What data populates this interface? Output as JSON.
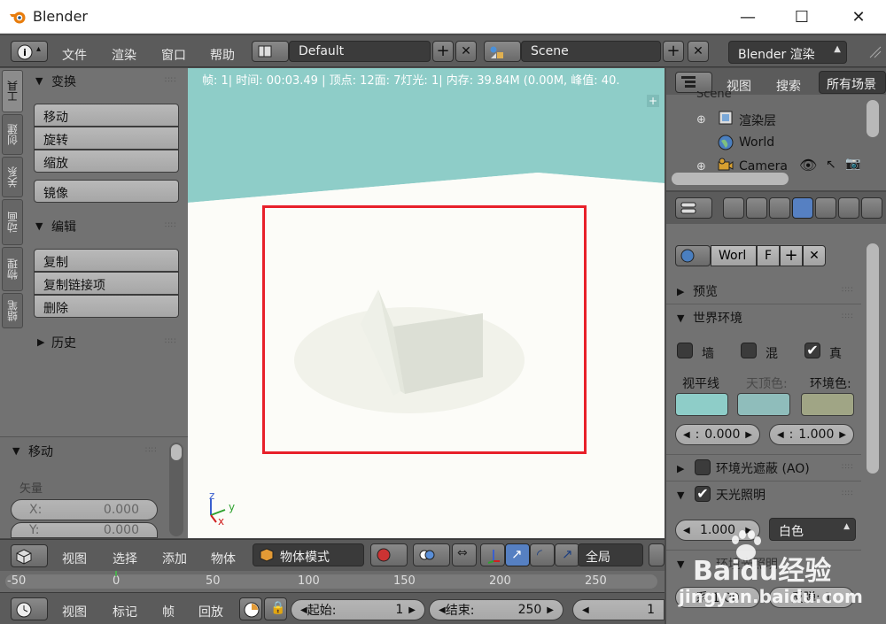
{
  "window": {
    "title": "Blender",
    "minimize": "—",
    "maximize": "☐",
    "close": "✕"
  },
  "topbar": {
    "menus": [
      "文件",
      "渲染",
      "窗口",
      "帮助"
    ],
    "layout_value": "Default",
    "scene_value": "Scene",
    "engine_value": "Blender 渲染"
  },
  "tabs": [
    "工具",
    "创建",
    "关系",
    "动画",
    "物理",
    "蜡笔"
  ],
  "toolshelf": {
    "transform_title": "变换",
    "transform_buttons": [
      "移动",
      "旋转",
      "缩放"
    ],
    "mirror": "镜像",
    "edit_title": "编辑",
    "edit_buttons": [
      "复制",
      "复制链接项",
      "删除"
    ],
    "history_title": "历史"
  },
  "operator_panel": {
    "title": "移动",
    "vector_label": "矢量",
    "x_label": "X:",
    "x_value": "0.000",
    "y_label": "Y:",
    "y_value": "0.000"
  },
  "viewport": {
    "info": "帧: 1| 时间: 00:03.49 | 顶点: 12面: 7灯光: 1| 内存: 39.84M (0.00M, 峰值: 40.",
    "axis_x": "x",
    "axis_y": "y",
    "axis_z": "z"
  },
  "outliner": {
    "view_menu": "视图",
    "search_menu": "搜索",
    "filter_value": "所有场景",
    "scene_item": "Scene",
    "items": [
      "渲染层",
      "World",
      "Camera"
    ]
  },
  "properties": {
    "world_name": "Worl",
    "fake_user": "F",
    "preview_title": "预览",
    "world_env_title": "世界环境",
    "checks": [
      {
        "label": "墙",
        "checked": false
      },
      {
        "label": "混",
        "checked": false
      },
      {
        "label": "真",
        "checked": true
      }
    ],
    "color_labels": [
      "视平线",
      "天顶色:",
      "环境色:"
    ],
    "colors": {
      "horizon": "#8ecdc8",
      "zenith": "#8fbdbb",
      "ambient": "#a0a585"
    },
    "field1_label": ":",
    "field1_value": "0.000",
    "field2_label": ":",
    "field2_value": "1.000",
    "ao_title": "环境光遮蔽 (AO)",
    "sky_title": "天光照明",
    "sky_value": "1.000",
    "sky_color": "白色",
    "partial_title": "环境光照明",
    "partial_field": "系   1.00",
    "partial_field2": "反弹: 1"
  },
  "view_header": {
    "menus": [
      "视图",
      "选择",
      "添加",
      "物体"
    ],
    "mode": "物体模式",
    "pivot": "全局"
  },
  "timeline": {
    "ticks": [
      "-50",
      "0",
      "50",
      "100",
      "150",
      "200",
      "250"
    ]
  },
  "timeline_header": {
    "menus": [
      "视图",
      "标记",
      "帧",
      "回放"
    ],
    "start_label": "起始:",
    "start_value": "1",
    "end_label": "结束:",
    "end_value": "250",
    "current_value": "1"
  },
  "watermark": {
    "brand": "Baidu经验",
    "url": "jingyan.baidu.com"
  }
}
